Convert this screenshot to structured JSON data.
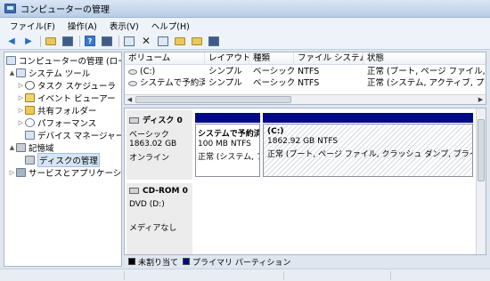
{
  "window": {
    "title": "コンピューターの管理"
  },
  "menu": [
    "ファイル(F)",
    "操作(A)",
    "表示(V)",
    "ヘルプ(H)"
  ],
  "toolbar": {
    "icons": [
      "back-arrow-icon",
      "forward-arrow-icon",
      "up-folder-icon",
      "console-tree-icon",
      "help-icon",
      "show-hide-icon",
      "refresh-icon",
      "delete-icon",
      "properties-icon",
      "open-folder-icon",
      "explore-icon",
      "wizard-icon"
    ]
  },
  "tree": {
    "items": [
      {
        "label": "コンピューターの管理 (ローカ",
        "level": 0,
        "expander": "",
        "icon": "computer-icon"
      },
      {
        "label": "システム ツール",
        "level": 1,
        "expander": "▲",
        "icon": "tools-icon"
      },
      {
        "label": "タスク スケジューラ",
        "level": 2,
        "expander": "▷",
        "icon": "clock-icon"
      },
      {
        "label": "イベント ビューアー",
        "level": 2,
        "expander": "▷",
        "icon": "event-icon"
      },
      {
        "label": "共有フォルダー",
        "level": 2,
        "expander": "▷",
        "icon": "folder-icon"
      },
      {
        "label": "パフォーマンス",
        "level": 2,
        "expander": "▷",
        "icon": "perf-icon"
      },
      {
        "label": "デバイス マネージャー",
        "level": 2,
        "expander": "",
        "icon": "device-icon"
      },
      {
        "label": "記憶域",
        "level": 1,
        "expander": "▲",
        "icon": "storage-icon"
      },
      {
        "label": "ディスクの管理",
        "level": 2,
        "expander": "",
        "icon": "disk-icon",
        "selected": true
      },
      {
        "label": "サービスとアプリケーショ",
        "level": 1,
        "expander": "▷",
        "icon": "services-icon"
      }
    ]
  },
  "volumes": {
    "columns": [
      "ボリューム",
      "レイアウト",
      "種類",
      "ファイル システム",
      "状態"
    ],
    "rows": [
      [
        "(C:)",
        "シンプル",
        "ベーシック",
        "NTFS",
        "正常 (ブート, ページ ファイル, クラ"
      ],
      [
        "システムで予約済み",
        "シンプル",
        "ベーシック",
        "NTFS",
        "正常 (システム, アクティブ, プライマ"
      ]
    ]
  },
  "disks": {
    "disk0": {
      "name": "ディスク 0",
      "type": "ベーシック",
      "size": "1863.02 GB",
      "status": "オンライン",
      "partitions": [
        {
          "name": "システムで予約済",
          "size": "100 MB NTFS",
          "status": "正常 (システム, フ"
        },
        {
          "name": "(C:)",
          "size": "1862.92 GB NTFS",
          "status": "正常 (ブート, ページ ファイル, クラッシュ ダンプ, プライマリ"
        }
      ]
    },
    "cdrom0": {
      "name": "CD-ROM 0",
      "drive": "DVD (D:)",
      "media": "メディアなし"
    }
  },
  "legend": {
    "unallocated": "未割り当て",
    "primary": "プライマリ パーティション",
    "colors": {
      "unallocated": "#000000",
      "primary": "#000a85"
    }
  }
}
